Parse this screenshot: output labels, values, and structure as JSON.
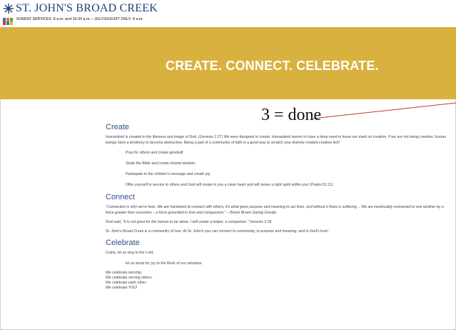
{
  "site": {
    "title": "ST. JOHN'S BROAD CREEK",
    "services": "SUNDAY SERVICES: 8 a.m. and 10:30 a.m. • JULY/AUGUST ONLY: 9 a.m."
  },
  "banner": {
    "tagline": "CREATE. CONNECT. CELEBRATE.",
    "color": "#d9b13f"
  },
  "annotation": {
    "text": "3 = done",
    "line_color": "#c0392b"
  },
  "sections": {
    "create": {
      "heading": "Create",
      "intro": "Humankind is created in the likeness and image of God. (Genesis 1:27) We were designed to create. Humankind seems to have a deep need to leave our mark on creation. If we are not being creative, human beings have a tendency to become destructive. Being a part of a community of faith is a good way to scratch your divinely created creative itch!",
      "items": [
        "Pray for others and create goodwill.",
        "Study the Bible and create shared wisdom.",
        "Participate in the children's message and create joy.",
        "Offer yourself in service to others and God will create in you a clean heart and will renew a right spirit within you! (Psalm 51:11)"
      ]
    },
    "connect": {
      "heading": "Connect",
      "quote": "\"Connection is why we're here. We are hardwired to connect with others, it's what gives purpose and meaning to our lives, and without it there is suffering… We are inextricably connected to one another by a force greater than ourselves – a force grounded in love and compassion.\" – Brené Brown Daring Greatly",
      "genesis_prefix": "God said, ",
      "genesis_quote": "\"It is not good for the human to be alone. I will create a helper, a companion.\"",
      "genesis_ref": " Genesis 2:18",
      "community": "St. John's Broad Creek is a community of love. At St. John's you can connect to community, to purpose and meaning, and to God's love!"
    },
    "celebrate": {
      "heading": "Celebrate",
      "line1": "Come, let us sing to the Lord;",
      "line2": "let us shout for joy to the Rock of our salvation.",
      "list": [
        "We celebrate worship.",
        "We celebrate serving others.",
        "We celebrate each other.",
        "We celebrate YOU!"
      ]
    }
  }
}
